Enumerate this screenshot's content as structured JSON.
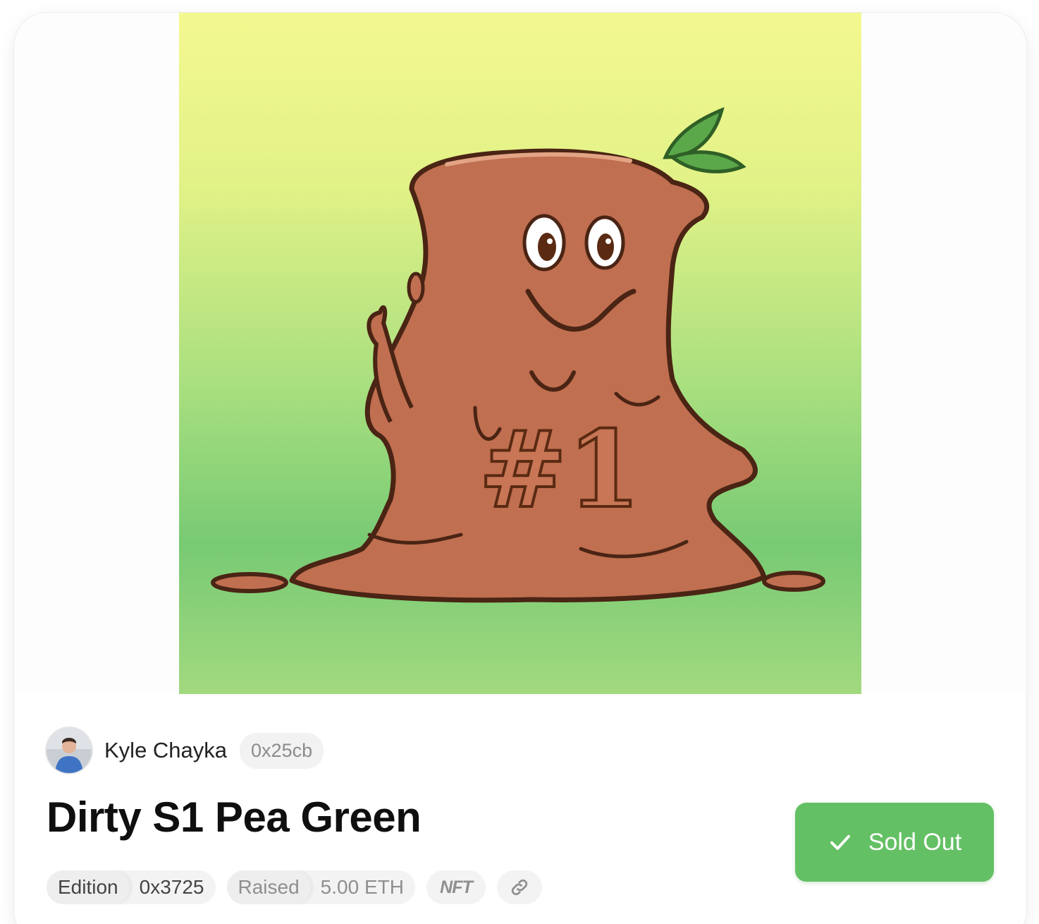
{
  "artwork": {
    "caption": "#1"
  },
  "creator": {
    "name": "Kyle Chayka",
    "address": "0x25cb"
  },
  "title": "Dirty S1 Pea Green",
  "meta": {
    "edition_label": "Edition",
    "edition_value": "0x3725",
    "raised_label": "Raised",
    "raised_value": "5.00 ETH",
    "nft_label": "NFT",
    "link_icon": "link-icon"
  },
  "status_button": {
    "label": "Sold Out",
    "icon": "checkmark-icon",
    "color": "#64c064"
  },
  "colors": {
    "gradient_top": "#f3f88f",
    "gradient_bottom": "#78ca74",
    "mud": "#c06f50"
  }
}
